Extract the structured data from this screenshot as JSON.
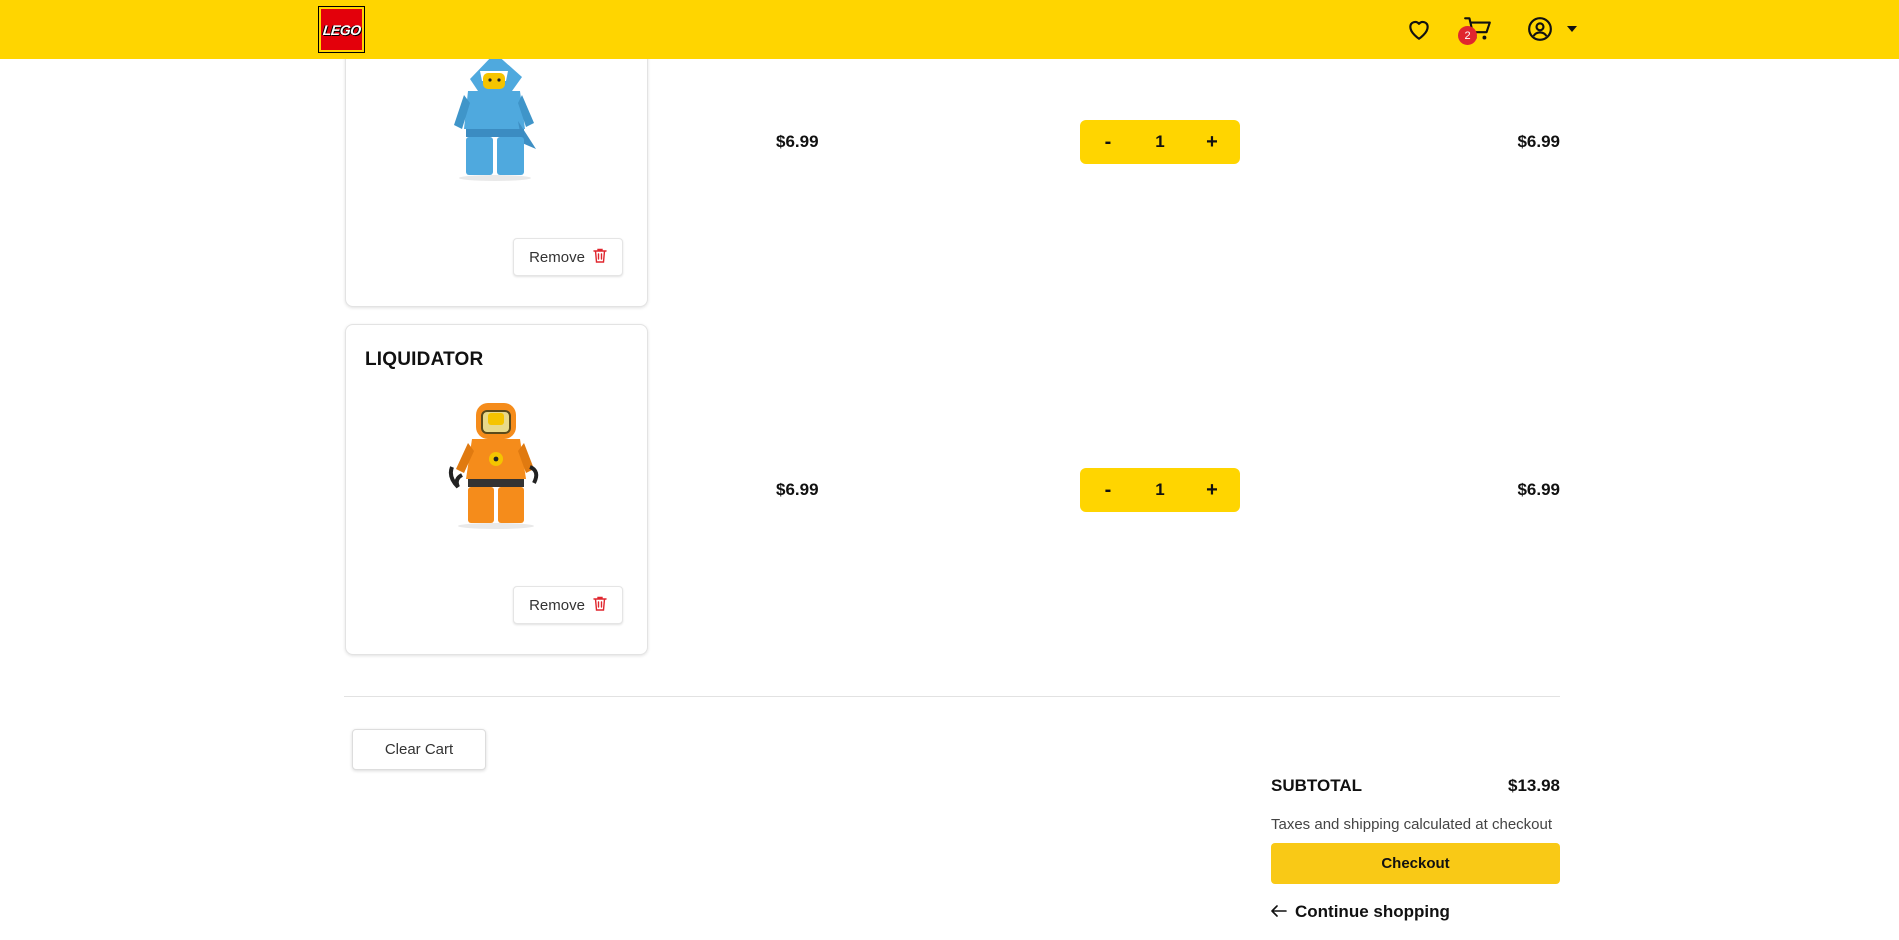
{
  "header": {
    "logo_text": "LEGO",
    "cart_count": "2",
    "colors": {
      "bar": "#FFD500",
      "logo": "#E3000B",
      "badge": "#E0262E"
    },
    "icons": [
      "heart-icon",
      "cart-icon",
      "user-circle-icon",
      "caret-down-icon"
    ]
  },
  "cart": {
    "items": [
      {
        "name": "",
        "price": "$6.99",
        "quantity": "1",
        "total": "$6.99",
        "remove_label": "Remove"
      },
      {
        "name": "LIQUIDATOR",
        "price": "$6.99",
        "quantity": "1",
        "total": "$6.99",
        "remove_label": "Remove"
      }
    ],
    "minus_label": "-",
    "plus_label": "+"
  },
  "actions": {
    "clear_label": "Clear Cart"
  },
  "summary": {
    "subtotal_label": "SUBTOTAL",
    "subtotal_value": "$13.98",
    "taxes_note": "Taxes and shipping calculated at checkout",
    "checkout_label": "Checkout",
    "continue_label": "Continue shopping"
  }
}
